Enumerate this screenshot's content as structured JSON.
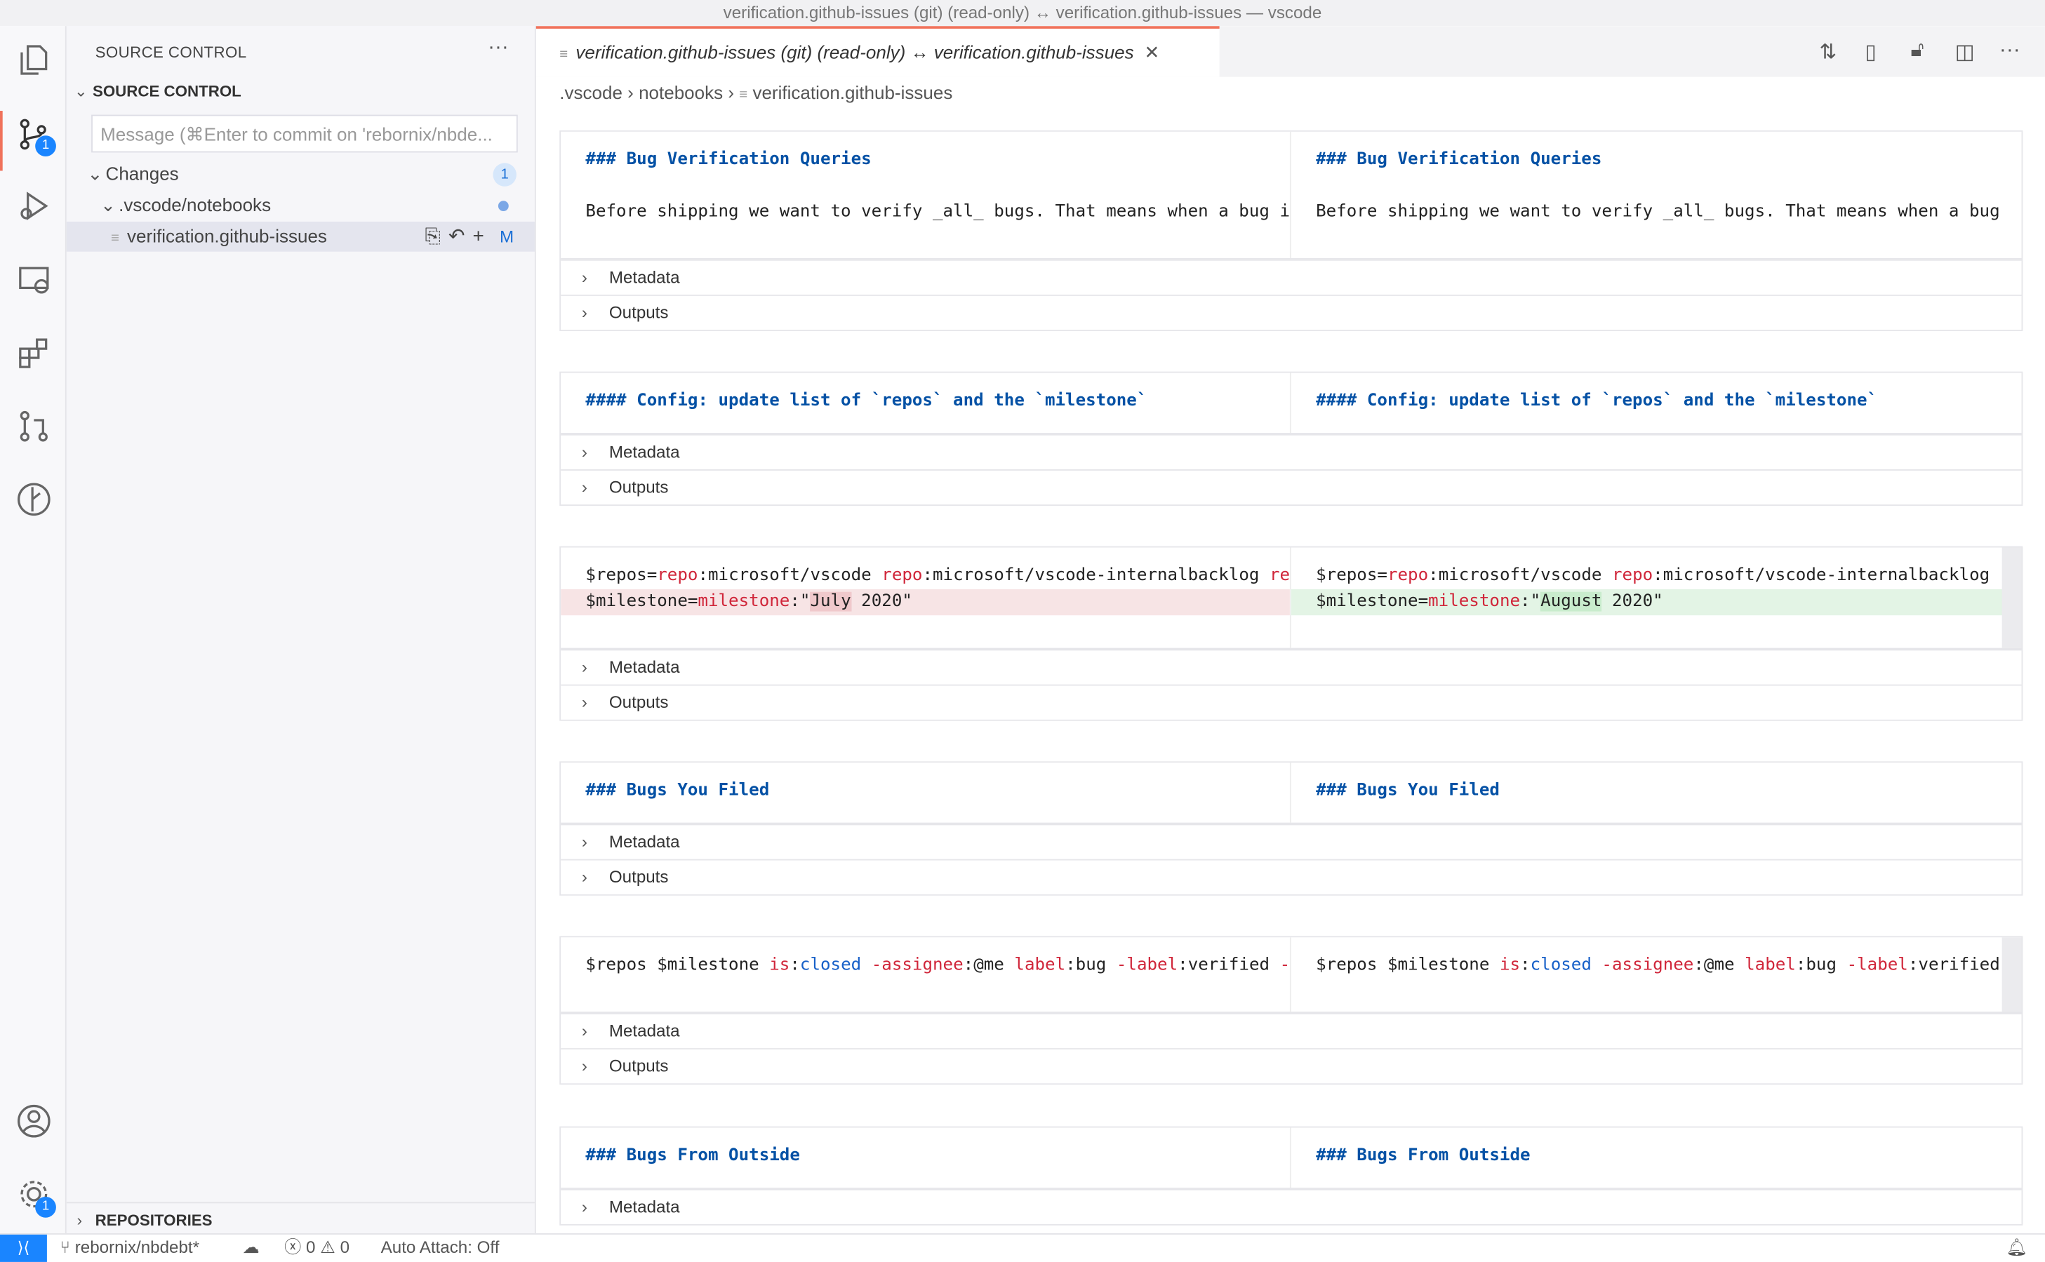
{
  "window_title": "verification.github-issues (git) (read-only) ↔ verification.github-issues — vscode",
  "activity_bar": {
    "items": [
      "explorer-icon",
      "source-control-icon",
      "run-debug-icon",
      "remote-explorer-icon",
      "extensions-icon",
      "pull-requests-icon",
      "git-graph-icon"
    ],
    "source_control_badge": "1",
    "accounts": "account-icon",
    "settings": "gear-icon",
    "settings_badge": "1"
  },
  "sidebar": {
    "title": "SOURCE CONTROL",
    "more": "···",
    "section": "SOURCE CONTROL",
    "message_placeholder": "Message (⌘Enter to commit on 'rebornix/nbde...",
    "changes_label": "Changes",
    "changes_count": "1",
    "folder": ".vscode/notebooks",
    "file": "verification.github-issues",
    "file_status": "M",
    "repositories": "REPOSITORIES"
  },
  "editor": {
    "tab_label": "verification.github-issues (git) (read-only) ↔ verification.github-issues",
    "breadcrumb": [
      ".vscode",
      "notebooks",
      "verification.github-issues"
    ],
    "cells": [
      {
        "height": 98,
        "lines": [
          [
            {
              "t": "### Bug Verification Queries",
              "c": "md"
            }
          ],
          [],
          [
            {
              "t": "Before shipping we want to verify _all_ bugs. That means when a bug is",
              "c": "txt"
            }
          ]
        ],
        "right": null,
        "folds": [
          "Metadata",
          "Outputs"
        ]
      },
      {
        "height": 47,
        "lines": [
          [
            {
              "t": "#### Config: update list of `repos` and the `milestone`",
              "c": "md"
            }
          ]
        ],
        "folds": [
          "Metadata",
          "Outputs"
        ]
      },
      {
        "height": 78,
        "code": true,
        "left": [
          [
            {
              "t": "$repos=",
              "c": "txt"
            },
            {
              "t": "repo",
              "c": "k"
            },
            {
              "t": ":microsoft/vscode ",
              "c": "txt"
            },
            {
              "t": "repo",
              "c": "k"
            },
            {
              "t": ":microsoft/vscode-internalbacklog ",
              "c": "txt"
            },
            {
              "t": "rep",
              "c": "k"
            }
          ],
          [
            {
              "t": "$milestone=",
              "c": "txt"
            },
            {
              "t": "milestone",
              "c": "k"
            },
            {
              "t": ":\"",
              "c": "txt"
            },
            {
              "t": "July",
              "c": "txt delw"
            },
            {
              "t": " 2020\"",
              "c": "txt"
            }
          ]
        ],
        "right": [
          [
            {
              "t": "$repos=",
              "c": "txt"
            },
            {
              "t": "repo",
              "c": "k"
            },
            {
              "t": ":microsoft/vscode ",
              "c": "txt"
            },
            {
              "t": "repo",
              "c": "k"
            },
            {
              "t": ":microsoft/vscode-internalbacklog ",
              "c": "txt"
            },
            {
              "t": "rep",
              "c": "k"
            }
          ],
          [
            {
              "t": "$milestone=",
              "c": "txt"
            },
            {
              "t": "milestone",
              "c": "k"
            },
            {
              "t": ":\"",
              "c": "txt"
            },
            {
              "t": "August",
              "c": "txt insw"
            },
            {
              "t": " 2020\"",
              "c": "txt"
            }
          ]
        ],
        "folds": [
          "Metadata",
          "Outputs"
        ]
      },
      {
        "height": 47,
        "lines": [
          [
            {
              "t": "### Bugs You Filed",
              "c": "md"
            }
          ]
        ],
        "folds": [
          "Metadata",
          "Outputs"
        ]
      },
      {
        "height": 58,
        "code": true,
        "lines": [
          [
            {
              "t": "$repos $milestone ",
              "c": "txt"
            },
            {
              "t": "is",
              "c": "k"
            },
            {
              "t": ":",
              "c": "txt"
            },
            {
              "t": "closed",
              "c": "v"
            },
            {
              "t": " -assignee",
              "c": "k"
            },
            {
              "t": ":@me ",
              "c": "txt"
            },
            {
              "t": "label",
              "c": "k"
            },
            {
              "t": ":bug ",
              "c": "txt"
            },
            {
              "t": "-label",
              "c": "k"
            },
            {
              "t": ":verified ",
              "c": "txt"
            },
            {
              "t": "-l",
              "c": "k"
            }
          ]
        ],
        "folds": [
          "Metadata",
          "Outputs"
        ]
      },
      {
        "height": 47,
        "lines": [
          [
            {
              "t": "### Bugs From Outside",
              "c": "md"
            }
          ]
        ],
        "folds": [
          "Metadata"
        ]
      }
    ]
  },
  "status_bar": {
    "branch": "rebornix/nbdebt*",
    "errors": "0",
    "warnings": "0",
    "auto_attach": "Auto Attach: Off"
  }
}
